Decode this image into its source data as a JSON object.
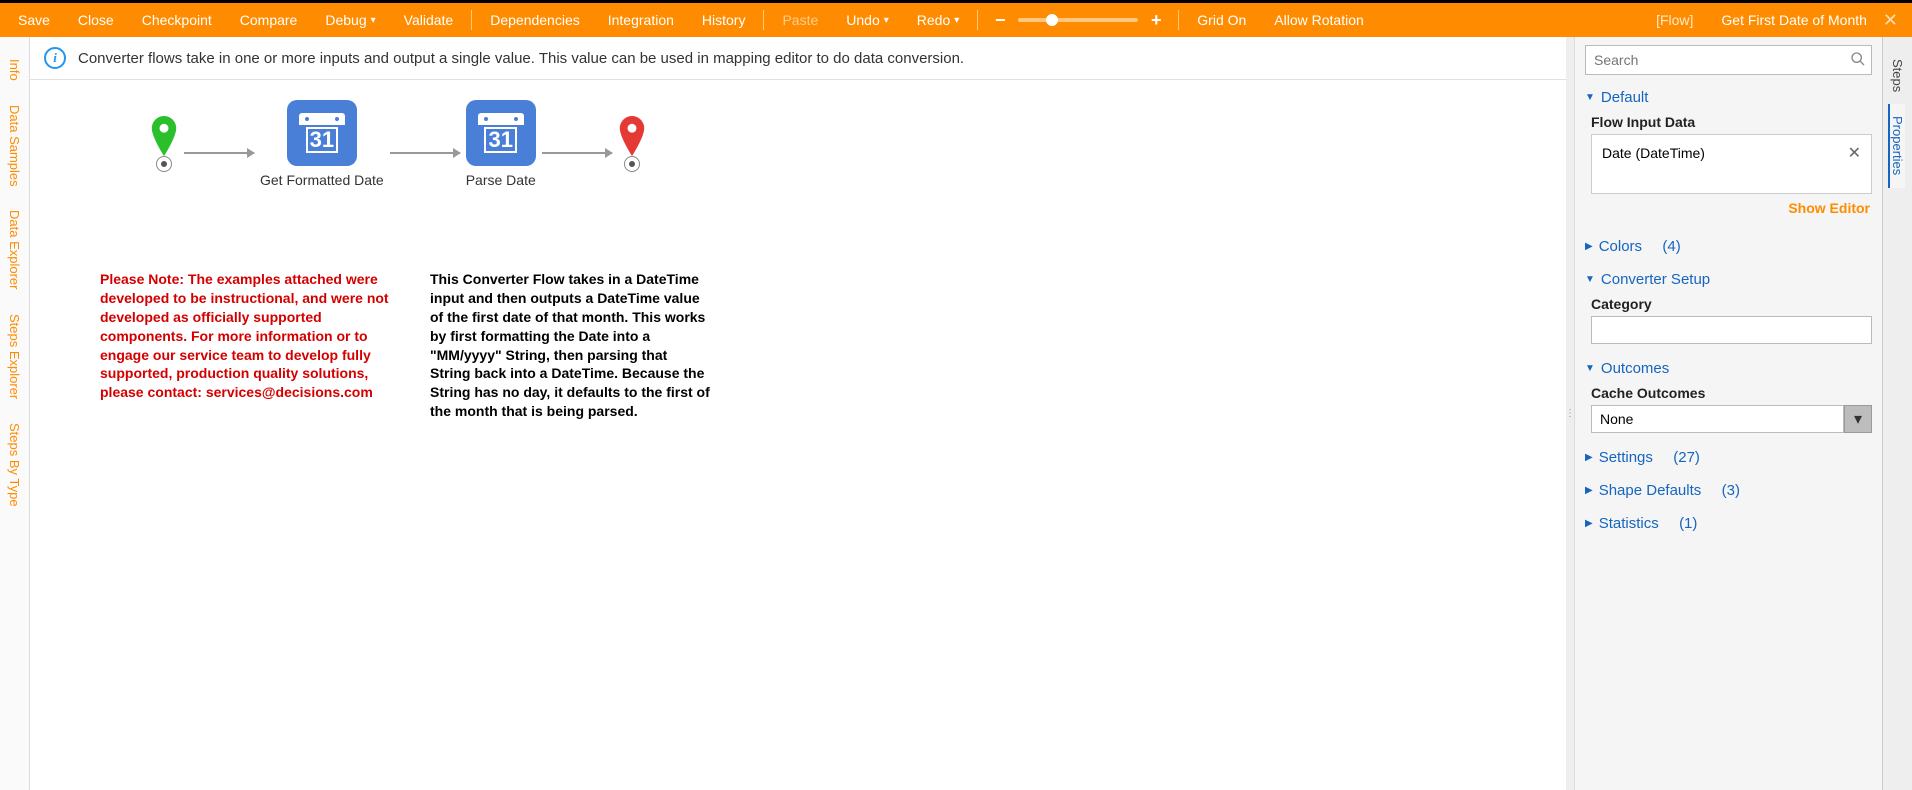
{
  "toolbar": {
    "save": "Save",
    "close": "Close",
    "checkpoint": "Checkpoint",
    "compare": "Compare",
    "debug": "Debug",
    "validate": "Validate",
    "dependencies": "Dependencies",
    "integration": "Integration",
    "history": "History",
    "paste": "Paste",
    "undo": "Undo",
    "redo": "Redo",
    "grid_on": "Grid On",
    "allow_rotation": "Allow Rotation",
    "flow_label": "[Flow]",
    "title": "Get First Date of Month"
  },
  "left_tabs": [
    "Info",
    "Data Samples",
    "Data Explorer",
    "Steps Explorer",
    "Steps By Type"
  ],
  "info_bar": "Converter flows take in one or more inputs and output a single value. This value can be used in mapping editor to do data conversion.",
  "flow": {
    "step1": "Get Formatted Date",
    "step2": "Parse Date",
    "cal_num": "31"
  },
  "notes": {
    "red": "Please Note: The examples attached were developed to be instructional, and were not developed as officially supported components.  For more information or to engage our service team to develop fully supported, production quality solutions, please contact: services@decisions.com",
    "black": "This Converter Flow takes in a DateTime input and then outputs a DateTime value of the first date of that month.  This works by first formatting the Date into a \"MM/yyyy\" String, then parsing that String back into a DateTime.  Because the String has no day, it defaults to the first of the month that is being parsed."
  },
  "right": {
    "search_placeholder": "Search",
    "sections": {
      "default": {
        "title": "Default",
        "flow_input_label": "Flow Input Data",
        "chip": "Date (DateTime)",
        "show_editor": "Show Editor"
      },
      "colors": {
        "title": "Colors",
        "count": "(4)"
      },
      "converter": {
        "title": "Converter Setup",
        "category_label": "Category"
      },
      "outcomes": {
        "title": "Outcomes",
        "cache_label": "Cache Outcomes",
        "cache_value": "None"
      },
      "settings": {
        "title": "Settings",
        "count": "(27)"
      },
      "shape": {
        "title": "Shape Defaults",
        "count": "(3)"
      },
      "stats": {
        "title": "Statistics",
        "count": "(1)"
      }
    }
  },
  "right_tabs": [
    "Steps",
    "Properties"
  ]
}
